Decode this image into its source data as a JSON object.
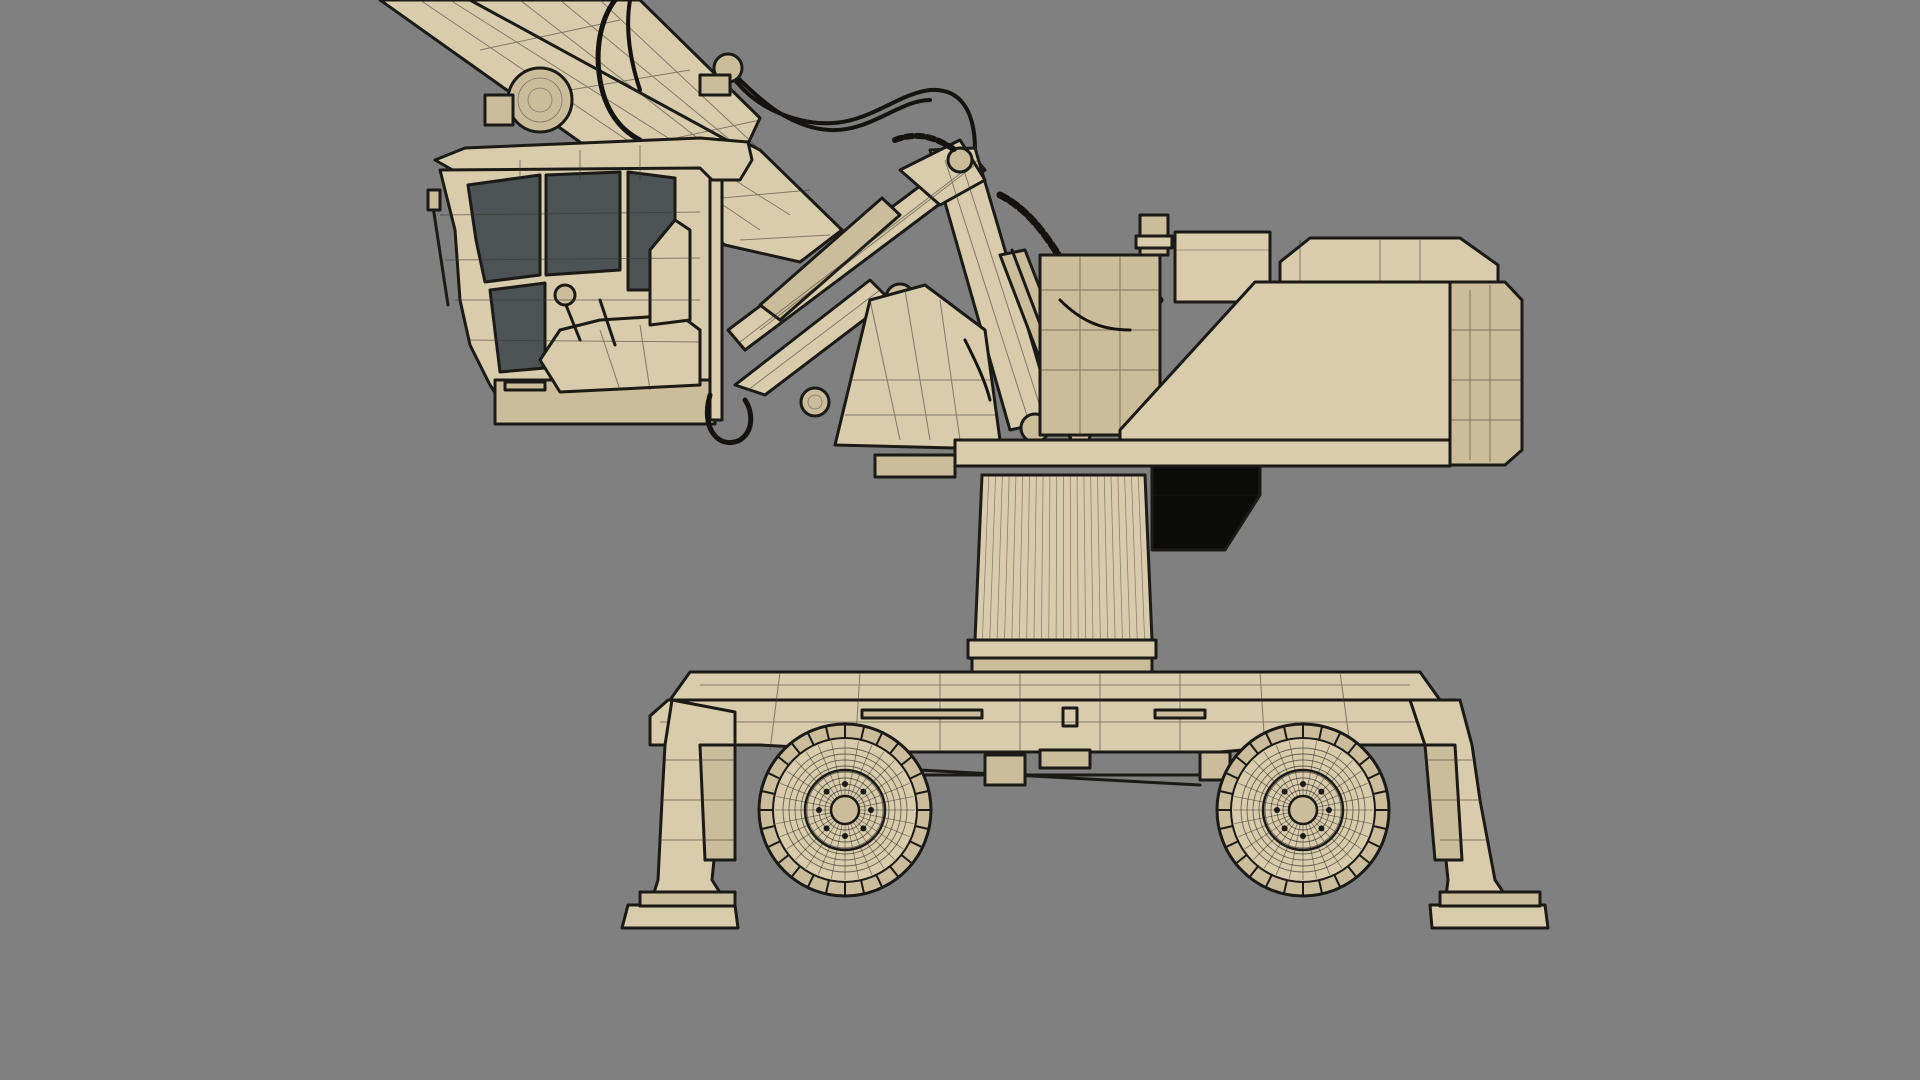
{
  "viewport": {
    "background_color": "#808080",
    "model_fill_color": "#d9ccad",
    "model_shade_color": "#cbbd9b",
    "wire_color": "#1b1a16",
    "glass_color": "#4b5354"
  },
  "model": {
    "subject": "wheeled-material-handler",
    "render_style": "wireframe-on-shaded",
    "view": "side-orthographic"
  }
}
